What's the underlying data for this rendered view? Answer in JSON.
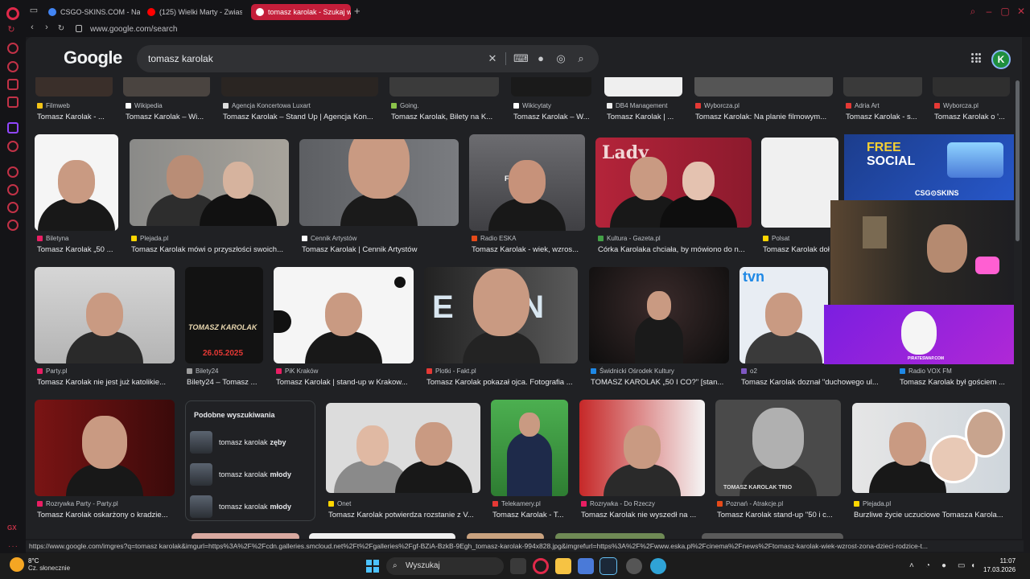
{
  "browser": {
    "tabs": [
      {
        "label": "CSGO-SKINS.COM - Naj",
        "favicon_color": "#4285f4"
      },
      {
        "label": "(125) Wielki Marty - Zwias",
        "favicon_color": "#ff0000"
      },
      {
        "label": "tomasz karolak - Szukaj w",
        "favicon_color": "#ffffff"
      }
    ],
    "url": "www.google.com/search"
  },
  "google": {
    "logo": "Google",
    "query": "tomasz karolak",
    "avatar_letter": "K"
  },
  "results_row1": [
    {
      "source": "Filmweb",
      "title": "Tomasz Karolak - ...",
      "color": "#f5c518"
    },
    {
      "source": "Wikipedia",
      "title": "Tomasz Karolak – Wi...",
      "color": "#ffffff"
    },
    {
      "source": "Agencja Koncertowa Luxart",
      "title": "Tomasz Karolak – Stand Up | Agencja Kon...",
      "color": "#dddddd"
    },
    {
      "source": "Going.",
      "title": "Tomasz Karolak, Bilety na K...",
      "color": "#8bc34a"
    },
    {
      "source": "Wikicytaty",
      "title": "Tomasz Karolak – W...",
      "color": "#ffffff"
    },
    {
      "source": "DB4 Management",
      "title": "Tomasz Karolak | ...",
      "color": "#eeeeee"
    },
    {
      "source": "Wyborcza.pl",
      "title": "Tomasz Karolak: Na planie filmowym...",
      "color": "#e53935"
    },
    {
      "source": "Adria Art",
      "title": "Tomasz Karolak - s...",
      "color": "#e53935"
    },
    {
      "source": "Wyborcza.pl",
      "title": "Tomasz Karolak o '...",
      "color": "#e53935"
    }
  ],
  "results_row2": [
    {
      "source": "Biletyna",
      "title": "Tomasz Karolak „50 ...",
      "color": "#e91e63"
    },
    {
      "source": "Plejada.pl",
      "title": "Tomasz Karolak mówi o przyszłości swoich...",
      "color": "#ffd600"
    },
    {
      "source": "Cennik Artystów",
      "title": "Tomasz Karolak | Cennik Artystów",
      "color": "#ffffff"
    },
    {
      "source": "Radio ESKA",
      "title": "Tomasz Karolak - wiek, wzros...",
      "color": "#e64a19"
    },
    {
      "source": "Kultura - Gazeta.pl",
      "title": "Córka Karolaka chciała, by mówiono do n...",
      "color": "#43a047"
    },
    {
      "source": "Polsat",
      "title": "Tomasz Karolak doł",
      "color": "#ffd600"
    }
  ],
  "results_row3": [
    {
      "source": "Party.pl",
      "title": "Tomasz Karolak nie jest już katolikie...",
      "color": "#e91e63"
    },
    {
      "source": "Bilety24",
      "title": "Bilety24 – Tomasz ...",
      "color": "#9e9e9e"
    },
    {
      "source": "PiK Kraków",
      "title": "Tomasz Karolak | stand-up w Krakow...",
      "color": "#e91e63"
    },
    {
      "source": "Plotki - Fakt.pl",
      "title": "Tomasz Karolak pokazał ojca. Fotografia ...",
      "color": "#e53935"
    },
    {
      "source": "Świdnicki Ośrodek Kultury",
      "title": "TOMASZ KAROLAK „50 I CO?\" [stan...",
      "color": "#1e88e5"
    },
    {
      "source": "o2",
      "title": "Tomasz Karolak doznał \"duchowego ul...",
      "color": "#7e57c2"
    },
    {
      "source": "Radio VOX FM",
      "title": "Tomasz Karolak był gościem ...",
      "color": "#1e88e5"
    }
  ],
  "results_row4": [
    {
      "source": "Rozrywka Party - Party.pl",
      "title": "Tomasz Karolak oskarżony o kradzie...",
      "color": "#e91e63"
    },
    {
      "source": "Onet",
      "title": "Tomasz Karolak potwierdza rozstanie z V...",
      "color": "#ffd600"
    },
    {
      "source": "Telekamery.pl",
      "title": "Tomasz Karolak - T...",
      "color": "#e53935"
    },
    {
      "source": "Rozrywka - Do Rzeczy",
      "title": "Tomasz Karolak nie wyszedł na ...",
      "color": "#e91e63"
    },
    {
      "source": "Poznań - Atrakcje.pl",
      "title": "Tomasz Karolak stand-up \"50 i c...",
      "color": "#e64a19"
    },
    {
      "source": "Plejada.pl",
      "title": "Burzliwe życie uczuciowe Tomasza Karola...",
      "color": "#ffd600"
    }
  ],
  "related": {
    "heading": "Podobne wyszukiwania",
    "items": [
      {
        "base": "tomasz karolak",
        "bold": "zęby"
      },
      {
        "base": "tomasz karolak",
        "bold": "młody"
      },
      {
        "base": "tomasz karolak",
        "bold": "młody"
      }
    ]
  },
  "overlay": {
    "free": "FREE",
    "social": "SOCIAL",
    "brand": "CSG⊙SKINS",
    "pirate": "PIRATESWAP.COM"
  },
  "image_text": {
    "poster_name": "TOMASZ KAROLAK",
    "poster_date": "26.05.2025",
    "tvn": "tvn",
    "trio": "TOMASZ KAROLAK TRIO",
    "etn": "E  TN",
    "fre": "FRE",
    "vanity": "Lady"
  },
  "status_url": "https://www.google.com/imgres?q=tomasz karolak&imgurl=https%3A%2F%2Fcdn.galleries.smcloud.net%2Ft%2Fgalleries%2Fgf-BZiA-BzkB-9Egh_tomasz-karolak-994x828.jpg&imgrefurl=https%3A%2F%2Fwww.eska.pl%2Fcinema%2Fnews%2Ftomasz-karolak-wiek-wzrost-zona-dzieci-rodzice-t...",
  "taskbar": {
    "temp": "8°C",
    "weather": "Cz. słonecznie",
    "search": "Wyszukaj",
    "time": "11:07",
    "date": "17.03.2026"
  }
}
